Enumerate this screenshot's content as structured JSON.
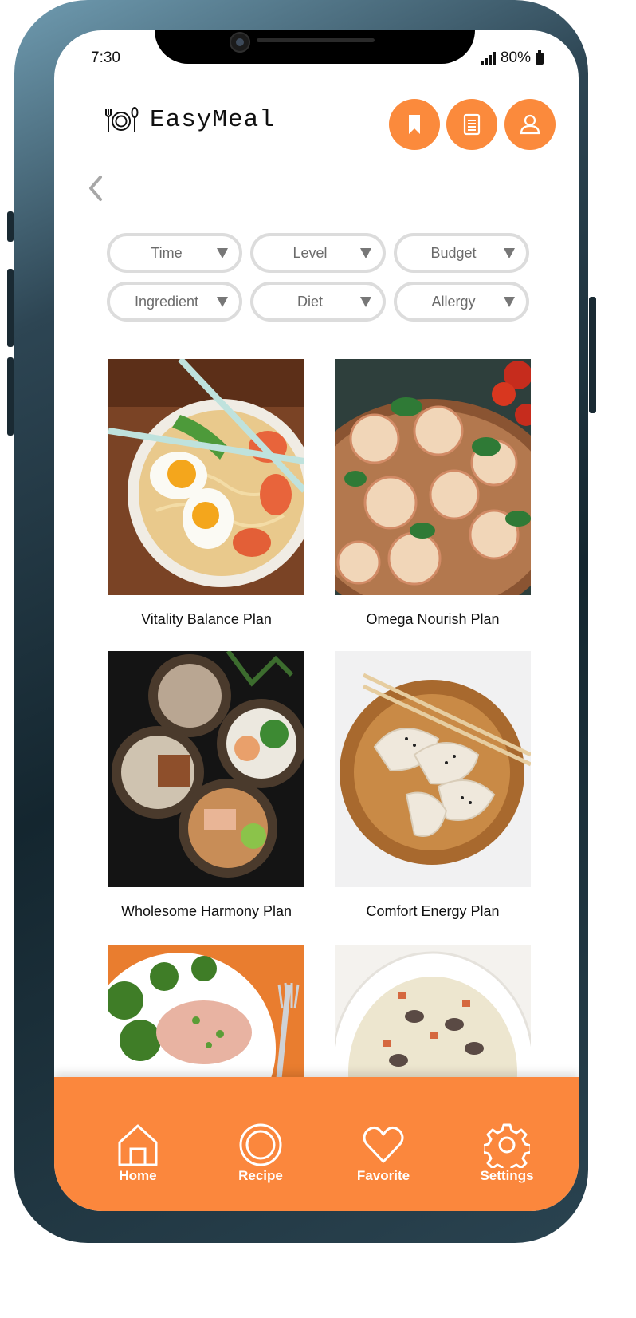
{
  "status_bar": {
    "time": "7:30",
    "battery": "80%"
  },
  "header": {
    "app_name": "EasyMeal"
  },
  "filters": [
    {
      "label": "Time"
    },
    {
      "label": "Level"
    },
    {
      "label": "Budget"
    },
    {
      "label": "Ingredient"
    },
    {
      "label": "Diet"
    },
    {
      "label": "Allergy"
    }
  ],
  "meal_plans": [
    {
      "title": "Vitality Balance Plan"
    },
    {
      "title": "Omega Nourish Plan"
    },
    {
      "title": "Wholesome Harmony Plan"
    },
    {
      "title": "Comfort Energy Plan"
    }
  ],
  "bottom_nav": [
    {
      "label": "Home",
      "icon": "home-icon"
    },
    {
      "label": "Recipe",
      "icon": "recipe-icon"
    },
    {
      "label": "Favorite",
      "icon": "heart-icon"
    },
    {
      "label": "Settings",
      "icon": "gear-icon"
    }
  ],
  "colors": {
    "accent": "#fb8a3c",
    "filter_border": "#dcdcdc"
  }
}
